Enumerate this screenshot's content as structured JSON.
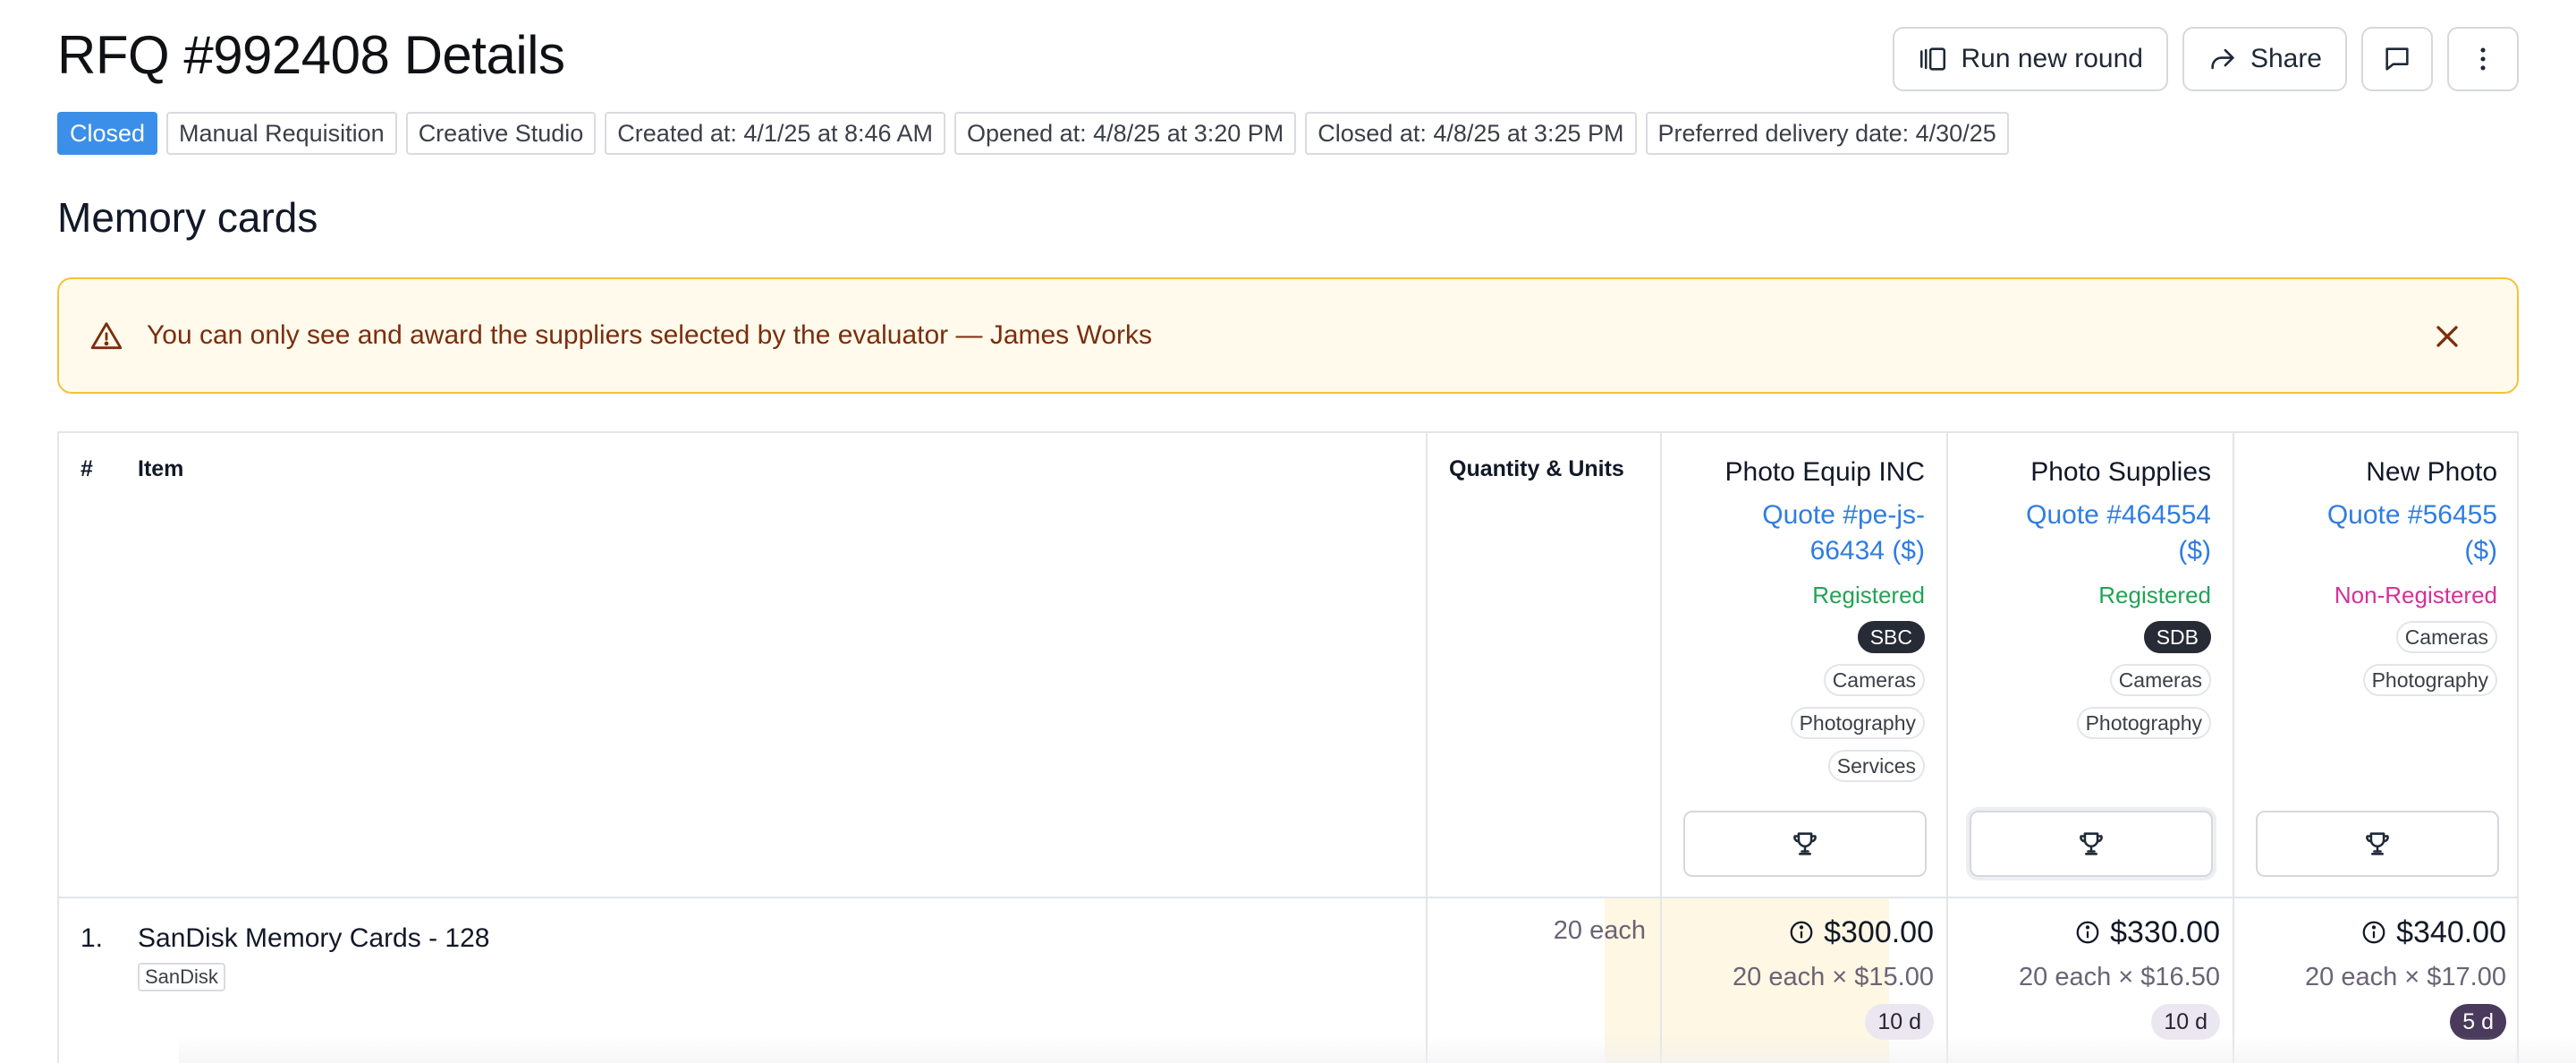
{
  "header": {
    "title": "RFQ #992408 Details",
    "run_new_round": "Run new round",
    "share": "Share"
  },
  "badges": {
    "status": "Closed",
    "type": "Manual Requisition",
    "department": "Creative Studio",
    "created": "Created at: 4/1/25 at 8:46 AM",
    "opened": "Opened at: 4/8/25 at 3:20 PM",
    "closed": "Closed at: 4/8/25 at 3:25 PM",
    "delivery": "Preferred delivery date: 4/30/25"
  },
  "section": {
    "title": "Memory cards"
  },
  "alert": {
    "message": "You can only see and award the suppliers selected by the evaluator — James Works",
    "border_color": "#f5c13d",
    "background": "#fffaeb"
  },
  "table": {
    "headers": {
      "num": "#",
      "item": "Item",
      "quantity": "Quantity & Units"
    },
    "suppliers": [
      {
        "name": "Photo Equip INC",
        "quote_line1": "Quote #pe-js-",
        "quote_line2": "66434 ($)",
        "status": "Registered",
        "code": "SBC",
        "tags": [
          "Cameras",
          "Photography",
          "Services"
        ]
      },
      {
        "name": "Photo Supplies",
        "quote_line1": "Quote #464554",
        "quote_line2": "($)",
        "status": "Registered",
        "code": "SDB",
        "tags": [
          "Cameras",
          "Photography"
        ]
      },
      {
        "name": "New Photo",
        "quote_line1": "Quote #56455",
        "quote_line2": "($)",
        "status": "Non-Registered",
        "tags": [
          "Cameras",
          "Photography"
        ]
      }
    ],
    "rows": [
      {
        "num": "1.",
        "item": "SanDisk Memory Cards - 128",
        "brand": "SanDisk",
        "quantity": "20 each",
        "prices": [
          {
            "amount": "$300.00",
            "calc": "20 each × $15.00",
            "lead": "10 d"
          },
          {
            "amount": "$330.00",
            "calc": "20 each × $16.50",
            "lead": "10 d"
          },
          {
            "amount": "$340.00",
            "calc": "20 each × $17.00",
            "lead": "5 d"
          }
        ]
      }
    ]
  },
  "colors": {
    "accent_blue": "#3b8fe8",
    "link_blue": "#2f7de1",
    "registered_green": "#22a355",
    "non_registered_pink": "#d5309a",
    "best_price_highlight": "#fdf7e3"
  },
  "icons": {
    "run_new_round": "columns-icon",
    "share": "share-icon",
    "comment": "comment-icon",
    "more": "more-vertical-icon",
    "warning": "warning-icon",
    "close": "close-icon",
    "award": "trophy-icon",
    "info": "info-icon"
  }
}
